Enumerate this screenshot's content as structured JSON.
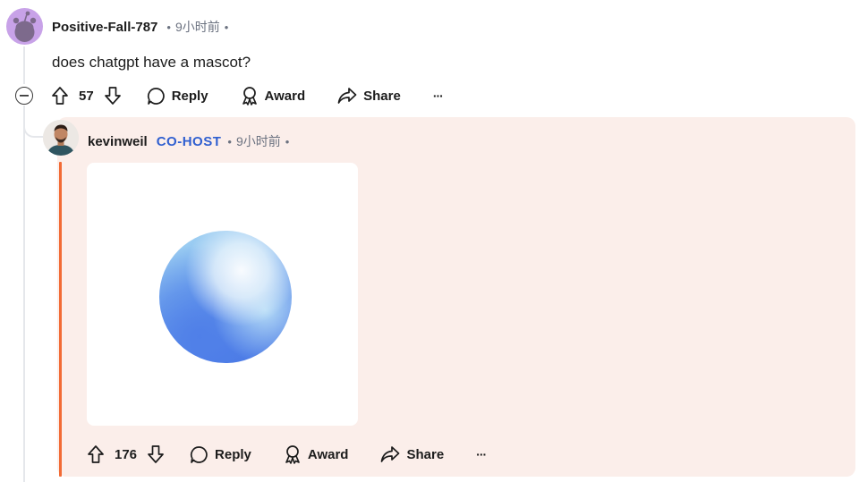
{
  "comment": {
    "username": "Positive-Fall-787",
    "time": "9小时前",
    "dot": "•",
    "text": "does chatgpt have a mascot?",
    "votes": "57",
    "actions": {
      "reply": "Reply",
      "award": "Award",
      "share": "Share",
      "more": "···"
    }
  },
  "reply": {
    "username": "kevinweil",
    "badge": "CO-HOST",
    "time": "9小时前",
    "dot": "•",
    "votes": "176",
    "actions": {
      "reply": "Reply",
      "award": "Award",
      "share": "Share",
      "more": "···"
    }
  },
  "colors": {
    "reply_background": "#fbeeea",
    "accent_rail": "#f26b35",
    "cohost_badge": "#2f5fd0",
    "avatar_background": "#c8a2e8"
  },
  "icons": [
    "snoo-avatar-icon",
    "collapse-icon",
    "upvote-icon",
    "downvote-icon",
    "reply-icon",
    "award-icon",
    "share-icon",
    "more-icon"
  ]
}
